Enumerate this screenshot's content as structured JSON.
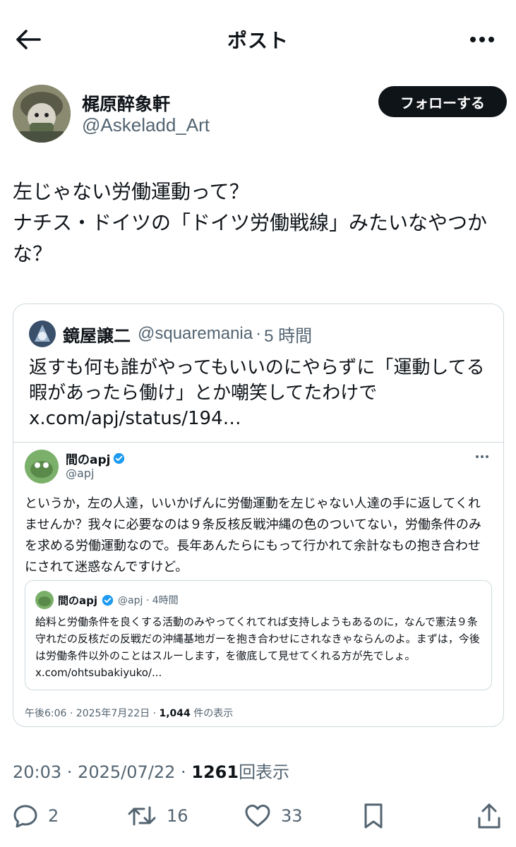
{
  "header": {
    "title": "ポスト",
    "back_icon": "arrow-left-icon",
    "more_icon": "more-horizontal-icon"
  },
  "author": {
    "name": "梶原醉象軒",
    "handle": "@Askeladd_Art",
    "follow_label": "フォローする"
  },
  "post": {
    "text": "左じゃない労働運動って？\nナチス・ドイツの「ドイツ労働戦線」みたいなやつかな？"
  },
  "quote": {
    "name": "鏡屋譲二",
    "handle": "@squaremania",
    "dot": "·",
    "time": "5 時間",
    "text": "返すも何も誰がやってもいいのにやらずに「運動してる暇があったら働け」とか嘲笑してたわけで x.com/apj/status/194…",
    "embedded": {
      "name": "間のapj",
      "handle": "@apj",
      "text": "というか，左の人達，いいかげんに労働運動を左じゃない人達の手に返してくれませんか？我々に必要なのは９条反核反戦沖縄の色のついてない，労働条件のみを求める労働運動なので。長年あんたらにもって行かれて余計なもの抱き合わせにされて迷惑なんですけど。",
      "quoted": {
        "name": "間のapj",
        "handle": "@apj · 4時間",
        "text": "給料と労働条件を良くする活動のみやってくれてれば支持しようもあるのに，なんで憲法９条守れだの反核だの反戦だの沖縄基地ガーを抱き合わせにされなきゃならんのよ。まずは，今後は労働条件以外のことはスルーします，を徹底して見せてくれる方が先でしょ。 x.com/ohtsubakiyuko/..."
      },
      "meta_time": "午後6:06 · 2025年7月22日 · ",
      "meta_views": "1,044",
      "meta_views_label": " 件の表示"
    }
  },
  "timestamp": {
    "text": "20:03 · 2025/07/22 · ",
    "views": "1261",
    "views_label": "回表示"
  },
  "actions": {
    "reply_count": "2",
    "repost_count": "16",
    "like_count": "33",
    "reply_icon": "reply-icon",
    "repost_icon": "repost-icon",
    "like_icon": "heart-icon",
    "bookmark_icon": "bookmark-icon",
    "share_icon": "share-icon"
  },
  "colors": {
    "text": "#0f1419",
    "muted": "#536471",
    "border": "#cfd9de",
    "verified": "#1d9bf0"
  }
}
